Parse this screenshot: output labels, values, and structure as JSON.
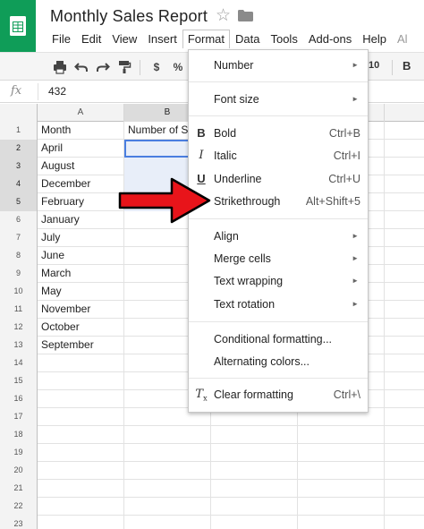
{
  "app": {
    "document_title": "Monthly Sales Report",
    "menu": [
      {
        "label": "File"
      },
      {
        "label": "Edit"
      },
      {
        "label": "View"
      },
      {
        "label": "Insert"
      },
      {
        "label": "Format"
      },
      {
        "label": "Data"
      },
      {
        "label": "Tools"
      },
      {
        "label": "Add-ons"
      },
      {
        "label": "Help"
      },
      {
        "label": "Al"
      }
    ],
    "active_menu": "Format"
  },
  "toolbar": {
    "currency_label": "$",
    "percent_label": "%",
    "font_size_value": "10",
    "bold_label": "B"
  },
  "formula_bar": {
    "fx_label": "fx",
    "value": "432"
  },
  "grid": {
    "column_headers": [
      "A",
      "B"
    ],
    "header_row_text": {
      "a": "Month",
      "b": "Number of S"
    },
    "months": [
      "April",
      "August",
      "December",
      "February",
      "January",
      "July",
      "June",
      "March",
      "May",
      "November",
      "October",
      "September"
    ],
    "row_numbers": [
      "1",
      "2",
      "3",
      "4",
      "5",
      "6",
      "7",
      "8",
      "9",
      "10",
      "11",
      "12",
      "13",
      "14",
      "15",
      "16",
      "17",
      "18",
      "19",
      "20",
      "21",
      "22",
      "23"
    ]
  },
  "format_menu": {
    "number": "Number",
    "font_size": "Font size",
    "bold": "Bold",
    "bold_shortcut": "Ctrl+B",
    "bold_icon": "B",
    "italic": "Italic",
    "italic_shortcut": "Ctrl+I",
    "italic_icon": "I",
    "underline": "Underline",
    "underline_shortcut": "Ctrl+U",
    "underline_icon": "U",
    "strikethrough": "Strikethrough",
    "strikethrough_shortcut": "Alt+Shift+5",
    "align": "Align",
    "merge_cells": "Merge cells",
    "text_wrapping": "Text wrapping",
    "text_rotation": "Text rotation",
    "conditional_formatting": "Conditional formatting...",
    "alternating_colors": "Alternating colors...",
    "clear_formatting": "Clear formatting",
    "clear_formatting_shortcut": "Ctrl+\\"
  },
  "icons": {
    "app_logo": "sheets-logo-icon",
    "star": "star-icon",
    "folder": "folder-icon",
    "print": "print-icon",
    "undo": "undo-icon",
    "redo": "redo-icon",
    "paint_format": "paint-format-icon",
    "clear_formatting": "clear-formatting-icon",
    "submenu_arrow": "chevron-right-icon"
  },
  "colors": {
    "sheets_green": "#0f9d58",
    "selection_fill": "#e8eef9",
    "selection_border": "#4a7ee0",
    "annotation_arrow": "#e8141a"
  }
}
